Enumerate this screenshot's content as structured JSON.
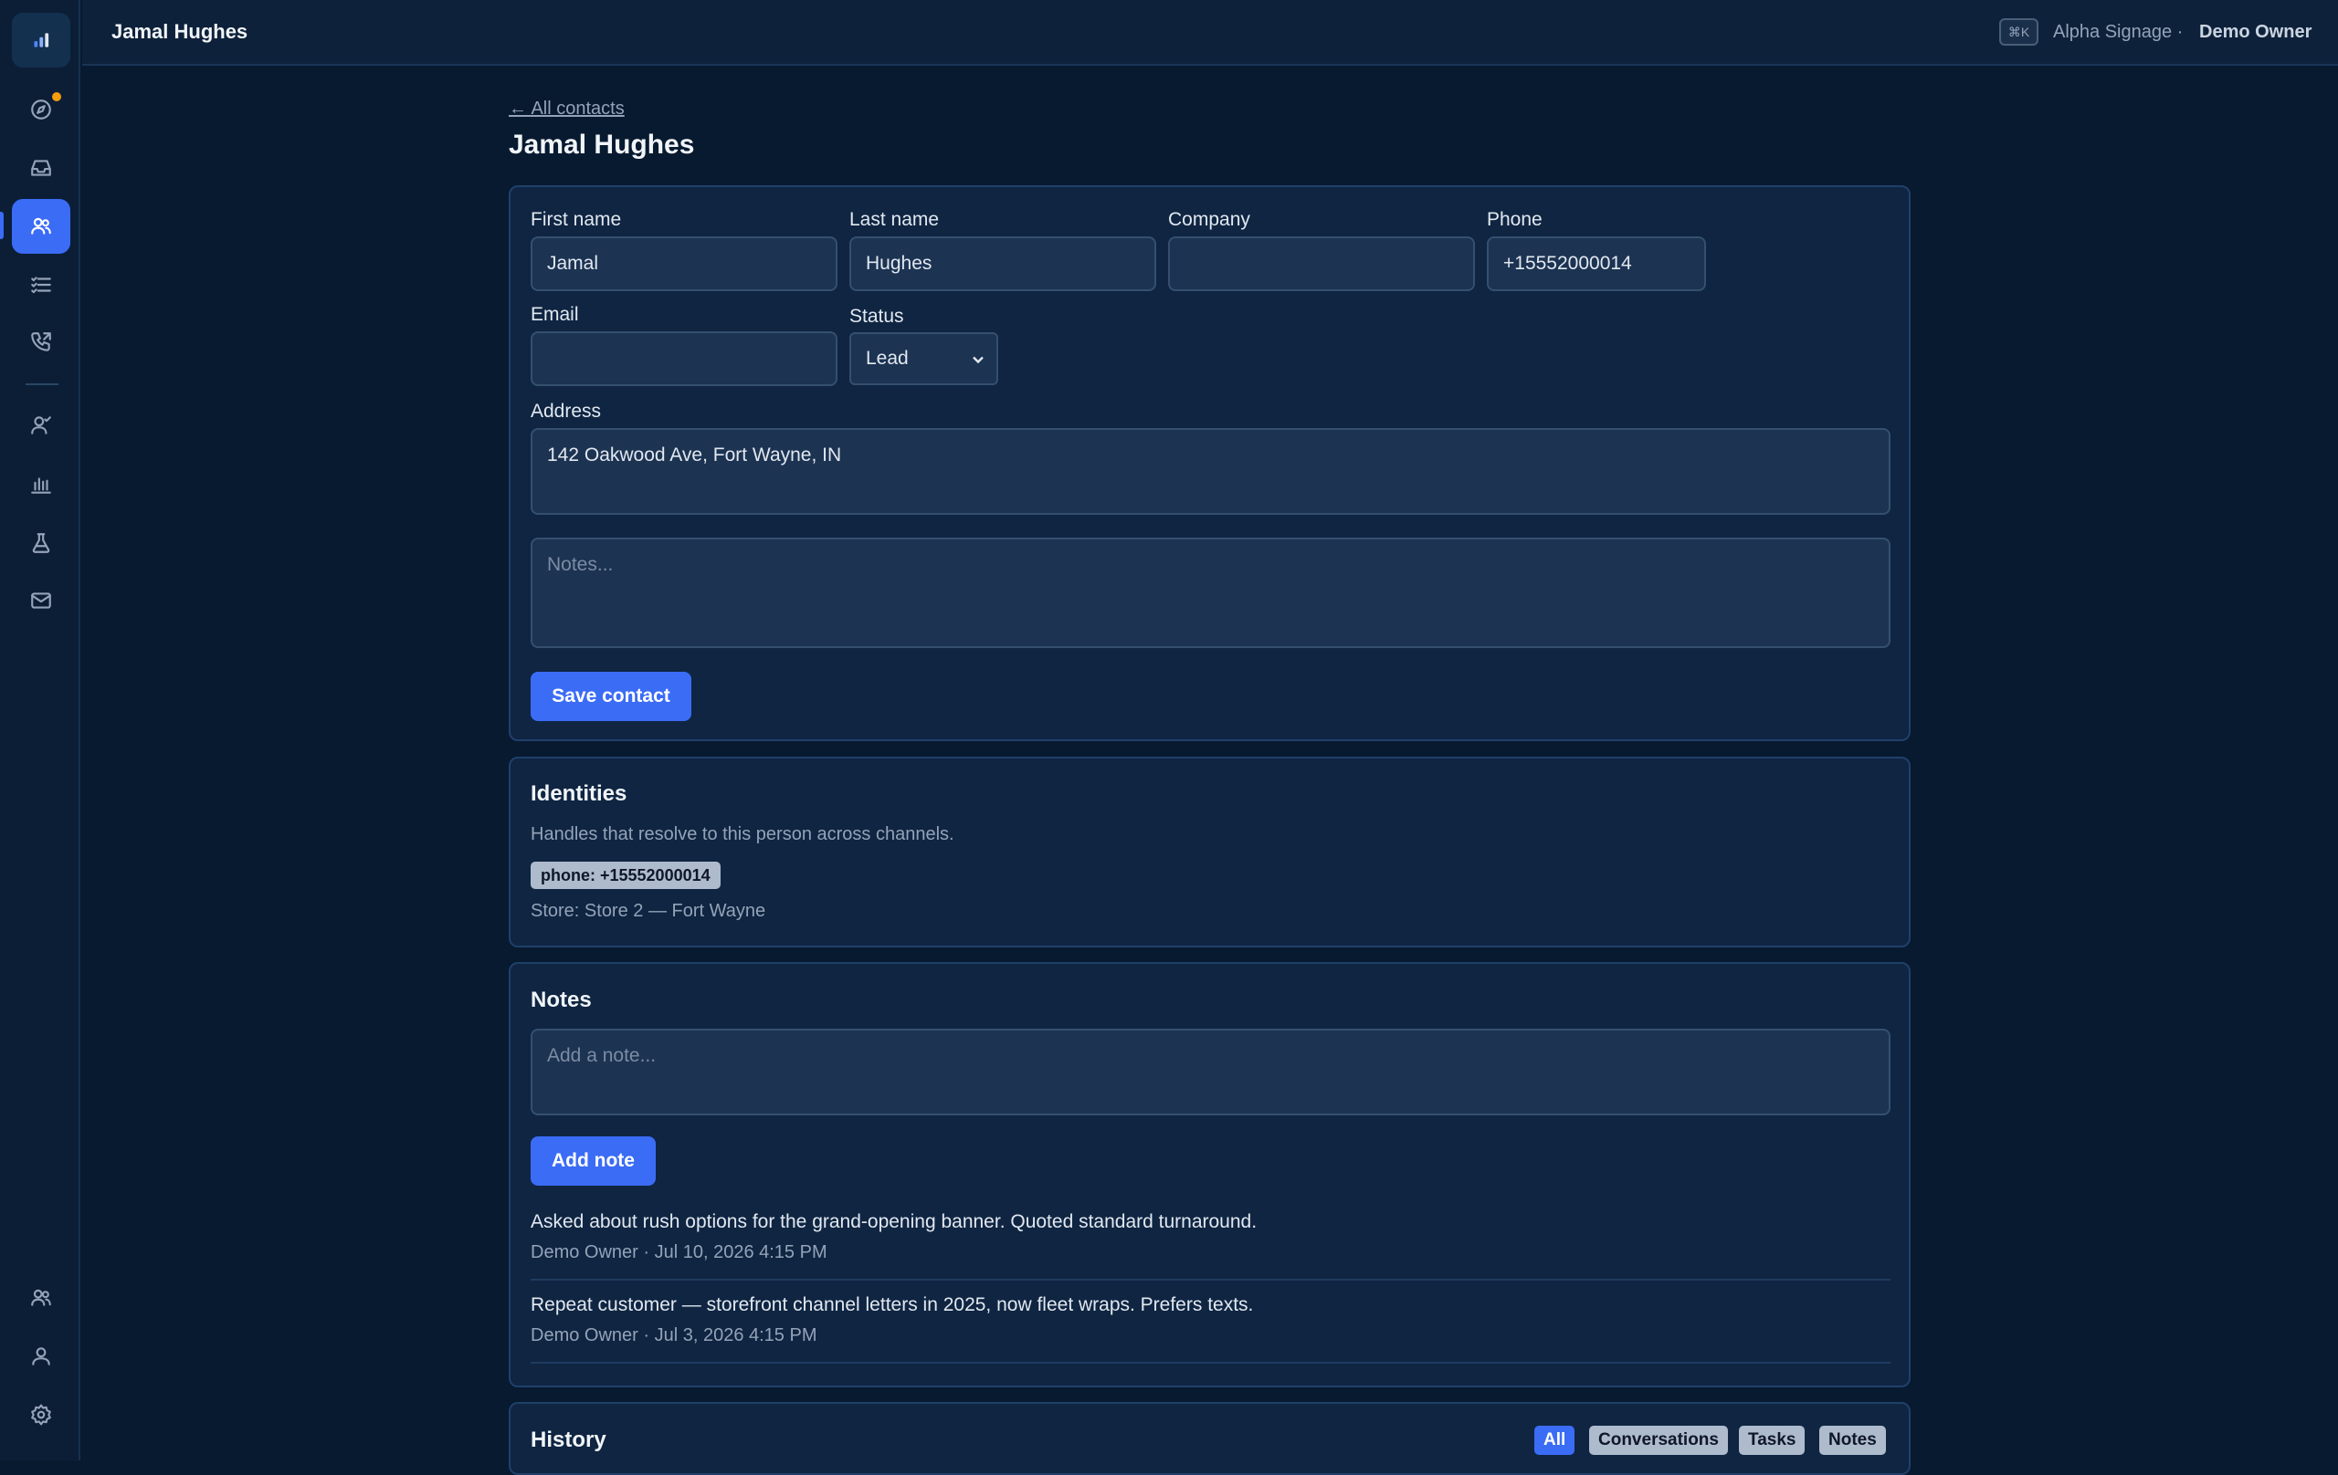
{
  "header": {
    "title": "Jamal Hughes",
    "shortcut": "⌘K",
    "org": "Alpha Signage ·",
    "user": "Demo Owner"
  },
  "sidebar": {
    "items": [
      {
        "name": "logo",
        "icon": "bar-chart-icon",
        "active": false
      },
      {
        "name": "explore",
        "icon": "compass-icon",
        "active": false,
        "dot": true
      },
      {
        "name": "inbox",
        "icon": "inbox-icon",
        "active": false
      },
      {
        "name": "contacts",
        "icon": "users-icon",
        "active": true
      },
      {
        "name": "tasks",
        "icon": "list-check-icon",
        "active": false
      },
      {
        "name": "calls",
        "icon": "phone-icon",
        "active": false
      },
      {
        "name": "agents",
        "icon": "user-check-icon",
        "active": false
      },
      {
        "name": "reports",
        "icon": "bar-chart-icon",
        "active": false
      },
      {
        "name": "experiments",
        "icon": "flask-icon",
        "active": false
      },
      {
        "name": "mail",
        "icon": "mail-icon",
        "active": false
      },
      {
        "name": "team",
        "icon": "users-icon",
        "active": false
      },
      {
        "name": "profile",
        "icon": "user-icon",
        "active": false
      },
      {
        "name": "settings",
        "icon": "gear-icon",
        "active": false
      }
    ],
    "accent": "#3b6cf6"
  },
  "page": {
    "back_link": "← All contacts",
    "title": "Jamal Hughes"
  },
  "form": {
    "first_name_label": "First name",
    "first_name_value": "Jamal",
    "last_name_label": "Last name",
    "last_name_value": "Hughes",
    "company_label": "Company",
    "company_value": "",
    "phone_label": "Phone",
    "phone_value": "+15552000014",
    "email_label": "Email",
    "email_value": "",
    "status_label": "Status",
    "status_value": "Lead",
    "address_label": "Address",
    "address_value": "142 Oakwood Ave, Fort Wayne, IN",
    "notes_placeholder": "Notes...",
    "save_label": "Save contact"
  },
  "identities": {
    "title": "Identities",
    "description": "Handles that resolve to this person across channels.",
    "badge": "phone: +15552000014",
    "store": "Store: Store 2 — Fort Wayne"
  },
  "notes": {
    "title": "Notes",
    "placeholder": "Add a note...",
    "add_label": "Add note",
    "items": [
      {
        "text": "Asked about rush options for the grand-opening banner. Quoted standard turnaround.",
        "meta": "Demo Owner · Jul 10, 2026 4:15 PM"
      },
      {
        "text": "Repeat customer — storefront channel letters in 2025, now fleet wraps. Prefers texts.",
        "meta": "Demo Owner · Jul 3, 2026 4:15 PM"
      }
    ]
  },
  "history": {
    "title": "History",
    "filters": [
      "All",
      "Conversations",
      "Tasks",
      "Notes"
    ],
    "active_filter": "All"
  }
}
